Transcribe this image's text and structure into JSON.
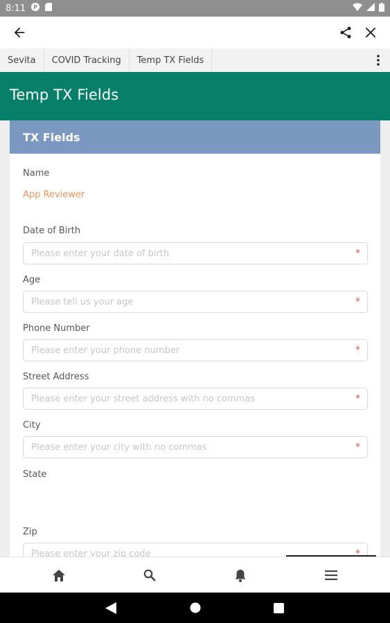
{
  "status_bar": {
    "time": "8:11"
  },
  "breadcrumb": {
    "items": [
      "Sevita",
      "COVID Tracking",
      "Temp TX Fields"
    ]
  },
  "page": {
    "title": "Temp TX Fields"
  },
  "card": {
    "title": "TX Fields"
  },
  "form": {
    "name_label": "Name",
    "name_value": "App Reviewer",
    "fields": [
      {
        "label": "Date of Birth",
        "placeholder": "Please enter your date of birth",
        "required_mark": "*"
      },
      {
        "label": "Age",
        "placeholder": "Please tell us your age",
        "required_mark": "*"
      },
      {
        "label": "Phone Number",
        "placeholder": "Please enter your phone number",
        "required_mark": "*"
      },
      {
        "label": "Street Address",
        "placeholder": "Please enter your street address with no commas",
        "required_mark": "*"
      },
      {
        "label": "City",
        "placeholder": "Please enter your city with no commas",
        "required_mark": "*"
      }
    ],
    "state_label": "State",
    "zip_label": "Zip",
    "zip_placeholder": "Please enter your zip code",
    "zip_required_mark": "*"
  },
  "icons": {
    "back": "arrow-left-icon",
    "share": "share-icon",
    "close": "close-icon",
    "more": "more-vertical-icon",
    "nav": [
      "home-icon",
      "search-icon",
      "bell-icon",
      "menu-icon"
    ],
    "system": [
      "back-triangle-icon",
      "home-circle-icon",
      "recents-square-icon"
    ]
  },
  "colors": {
    "status_bar": "#8f8f8f",
    "header": "#07806a",
    "card_header": "#7a98c0",
    "name_value": "#e8945a",
    "required": "#e8584a"
  }
}
